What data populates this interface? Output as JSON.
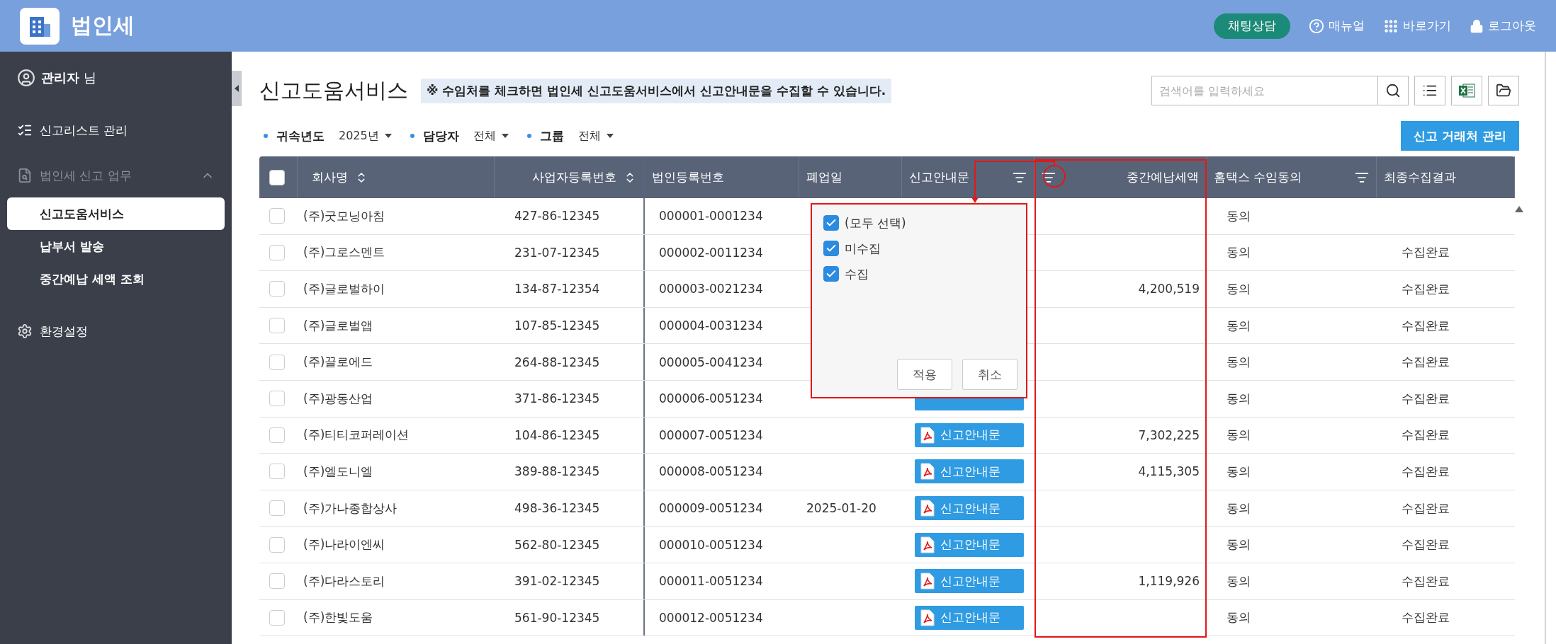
{
  "header": {
    "app_title": "법인세",
    "chat_button": "채팅상담",
    "links": [
      {
        "kind": "help",
        "label": "매뉴얼"
      },
      {
        "kind": "grid",
        "label": "바로가기"
      },
      {
        "kind": "lock",
        "label": "로그아웃"
      }
    ]
  },
  "sidebar": {
    "user": {
      "name": "관리자",
      "suffix": "님"
    },
    "items": [
      {
        "kind": "list",
        "label": "신고리스트 관리"
      },
      {
        "kind": "doc",
        "label": "법인세 신고 업무",
        "expanded": true,
        "children": [
          {
            "label": "신고도움서비스",
            "selected": true
          },
          {
            "label": "납부서 발송",
            "selected": false
          },
          {
            "label": "중간예납 세액 조회",
            "selected": false
          }
        ]
      },
      {
        "kind": "gear",
        "label": "환경설정"
      }
    ]
  },
  "page": {
    "title": "신고도움서비스",
    "notice": "※ 수임처를 체크하면 법인세 신고도움서비스에서 신고안내문을 수집할 수 있습니다.",
    "search": {
      "placeholder": "검색어를 입력하세요"
    }
  },
  "filters": [
    {
      "label": "귀속년도",
      "value": "2025년"
    },
    {
      "label": "담당자",
      "value": "전체"
    },
    {
      "label": "그룹",
      "value": "전체"
    }
  ],
  "manage_button": "신고 거래처 관리",
  "table": {
    "all_checked": false,
    "columns": [
      {
        "label": "회사명",
        "kind": "sort"
      },
      {
        "label": "사업자등록번호",
        "kind": "sort_right"
      },
      {
        "label": "법인등록번호",
        "kind": "plain"
      },
      {
        "label": "폐업일",
        "kind": "plain"
      },
      {
        "label": "신고안내문",
        "kind": "filter"
      },
      {
        "label": "중간예납세액",
        "kind": "filter_left"
      },
      {
        "label": "홈택스 수임동의",
        "kind": "filter"
      },
      {
        "label": "최종수집결과",
        "kind": "plain"
      }
    ],
    "rows": [
      {
        "checked": false,
        "company": "(주)굿모닝아침",
        "biz_no": "427-86-12345",
        "corp_no": "000001-0001234",
        "agree": "동의"
      },
      {
        "checked": false,
        "company": "(주)그로스멘트",
        "biz_no": "231-07-12345",
        "corp_no": "000002-0011234",
        "agree": "동의",
        "result": "수집완료"
      },
      {
        "checked": false,
        "company": "(주)글로벌하이",
        "biz_no": "134-87-12354",
        "corp_no": "000003-0021234",
        "amount": "4,200,519",
        "agree": "동의",
        "result": "수집완료"
      },
      {
        "checked": false,
        "company": "(주)글로벌앱",
        "biz_no": "107-85-12345",
        "corp_no": "000004-0031234",
        "agree": "동의",
        "result": "수집완료"
      },
      {
        "checked": false,
        "company": "(주)끌로에드",
        "biz_no": "264-88-12345",
        "corp_no": "000005-0041234",
        "agree": "동의",
        "result": "수집완료"
      },
      {
        "checked": false,
        "company": "(주)광동산업",
        "biz_no": "371-86-12345",
        "corp_no": "000006-0051234",
        "guide": {
          "kind": "covered"
        },
        "agree": "동의",
        "result": "수집완료"
      },
      {
        "checked": false,
        "company": "(주)티티코퍼레이션",
        "biz_no": "104-86-12345",
        "corp_no": "000007-0051234",
        "guide": {
          "kind": "button",
          "label": "신고안내문"
        },
        "amount": "7,302,225",
        "agree": "동의",
        "result": "수집완료"
      },
      {
        "checked": false,
        "company": "(주)엘도니엘",
        "biz_no": "389-88-12345",
        "corp_no": "000008-0051234",
        "guide": {
          "kind": "button",
          "label": "신고안내문"
        },
        "amount": "4,115,305",
        "agree": "동의",
        "result": "수집완료"
      },
      {
        "checked": false,
        "company": "(주)가나종합상사",
        "biz_no": "498-36-12345",
        "corp_no": "000009-0051234",
        "closed": "2025-01-20",
        "guide": {
          "kind": "button",
          "label": "신고안내문"
        },
        "agree": "동의",
        "result": "수집완료"
      },
      {
        "checked": false,
        "company": "(주)나라이엔씨",
        "biz_no": "562-80-12345",
        "corp_no": "000010-0051234",
        "guide": {
          "kind": "button",
          "label": "신고안내문"
        },
        "agree": "동의",
        "result": "수집완료"
      },
      {
        "checked": false,
        "company": "(주)다라스토리",
        "biz_no": "391-02-12345",
        "corp_no": "000011-0051234",
        "guide": {
          "kind": "button",
          "label": "신고안내문"
        },
        "amount": "1,119,926",
        "agree": "동의",
        "result": "수집완료"
      },
      {
        "checked": false,
        "company": "(주)한빛도움",
        "biz_no": "561-90-12345",
        "corp_no": "000012-0051234",
        "guide": {
          "kind": "button",
          "label": "신고안내문"
        },
        "agree": "동의",
        "result": "수집완료"
      }
    ]
  },
  "filter_popup": {
    "options": [
      {
        "label": "(모두 선택)",
        "checked": true
      },
      {
        "label": "미수집",
        "checked": true
      },
      {
        "label": "수집",
        "checked": true
      }
    ],
    "buttons": [
      "적용",
      "취소"
    ]
  }
}
